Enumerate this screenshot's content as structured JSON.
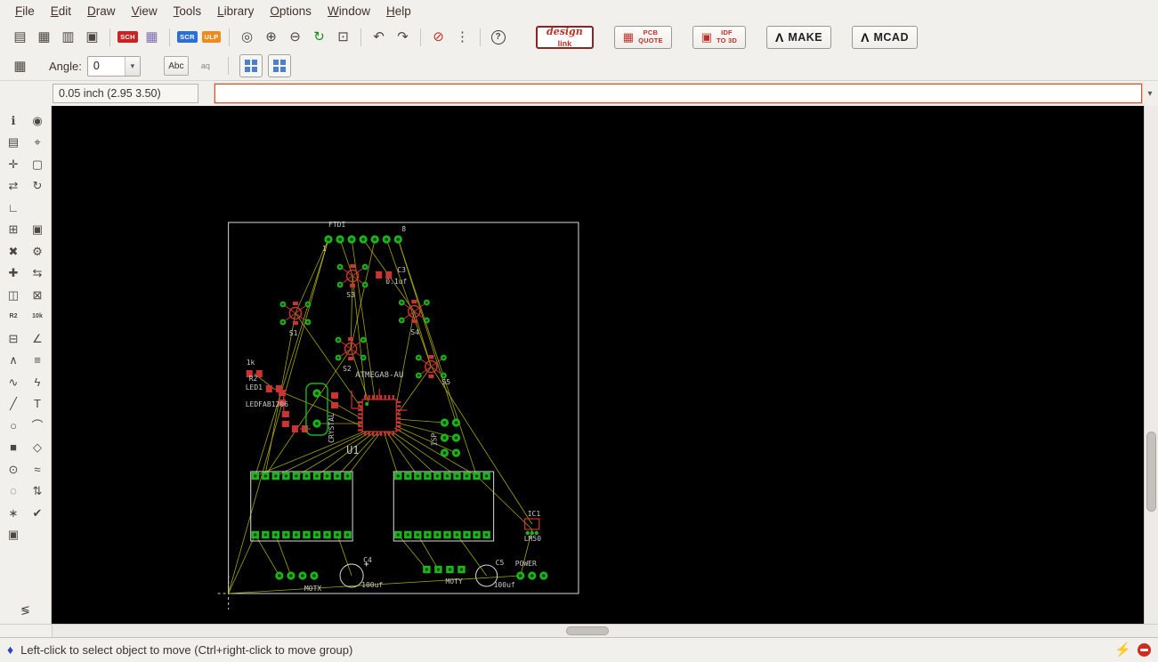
{
  "menu": {
    "items": [
      {
        "name": "menu-file",
        "label": "File"
      },
      {
        "name": "menu-edit",
        "label": "Edit"
      },
      {
        "name": "menu-draw",
        "label": "Draw"
      },
      {
        "name": "menu-view",
        "label": "View"
      },
      {
        "name": "menu-tools",
        "label": "Tools"
      },
      {
        "name": "menu-library",
        "label": "Library"
      },
      {
        "name": "menu-options",
        "label": "Options"
      },
      {
        "name": "menu-window",
        "label": "Window"
      },
      {
        "name": "menu-help",
        "label": "Help"
      }
    ]
  },
  "toolbar_main": {
    "items": [
      {
        "name": "open-button",
        "glyph": "▤"
      },
      {
        "name": "save-button",
        "glyph": "▦"
      },
      {
        "name": "print-button",
        "glyph": "▥"
      },
      {
        "name": "export-image-button",
        "glyph": "▣"
      },
      {
        "name": "separator",
        "glyph": "",
        "cls": "sep",
        "interactable": false
      },
      {
        "name": "schematic-button",
        "glyph": "SCH",
        "cls": "badge"
      },
      {
        "name": "layers-grid-button",
        "glyph": "▦",
        "cls": "c-grid"
      },
      {
        "name": "separator",
        "glyph": "",
        "cls": "sep",
        "interactable": false
      },
      {
        "name": "script-button",
        "glyph": "SCR",
        "cls": "badge badge-blue"
      },
      {
        "name": "ulp-button",
        "glyph": "ULP",
        "cls": "badge badge-orange"
      },
      {
        "name": "separator",
        "glyph": "",
        "cls": "sep",
        "interactable": false
      },
      {
        "name": "zoom-fit-button",
        "glyph": "◎"
      },
      {
        "name": "zoom-in-button",
        "glyph": "⊕"
      },
      {
        "name": "zoom-out-button",
        "glyph": "⊖"
      },
      {
        "name": "zoom-redraw-button",
        "glyph": "↻",
        "cls": "c-green"
      },
      {
        "name": "zoom-select-button",
        "glyph": "⊡"
      },
      {
        "name": "separator",
        "glyph": "",
        "cls": "sep",
        "interactable": false
      },
      {
        "name": "undo-button",
        "glyph": "↶"
      },
      {
        "name": "redo-button",
        "glyph": "↷"
      },
      {
        "name": "separator",
        "glyph": "",
        "cls": "sep",
        "interactable": false
      },
      {
        "name": "stop-button",
        "glyph": "⊘",
        "cls": "c-red"
      },
      {
        "name": "options-dots-button",
        "glyph": "⋮"
      },
      {
        "name": "separator",
        "glyph": "",
        "cls": "sep",
        "interactable": false
      },
      {
        "name": "help-button",
        "glyph": "?",
        "cls": "circle"
      }
    ]
  },
  "vendor": {
    "design_top": "design",
    "design_bottom": "link",
    "pcb_icon": "▦",
    "pcb_line1": "PCB",
    "pcb_line2": "QUOTE",
    "idf_icon": "▣",
    "idf_line1": "IDF",
    "idf_line2": "TO 3D",
    "make_logo": "Λ",
    "make_label": "MAKE",
    "mcad_logo": "Λ",
    "mcad_label": "MCAD"
  },
  "toolbar_params": {
    "grid_icon": "▦",
    "angle_label": "Angle:",
    "angle_value": "0",
    "abc_label": "Abc",
    "ratio_label": "aq",
    "dropdown_icon": "▾"
  },
  "command_bar": {
    "coordinates": "0.05 inch (2.95 3.50)",
    "value": ""
  },
  "left_tools": {
    "items": [
      {
        "name": "info-tool",
        "glyph": "ℹ"
      },
      {
        "name": "show-tool",
        "glyph": "◉"
      },
      {
        "name": "display-layers-tool",
        "glyph": "▤",
        "cls": "c-blue"
      },
      {
        "name": "mark-tool",
        "glyph": "⌖"
      },
      {
        "name": "move-tool",
        "glyph": "✛"
      },
      {
        "name": "group-tool",
        "glyph": "▢"
      },
      {
        "name": "mirror-tool",
        "glyph": "⇄"
      },
      {
        "name": "rotate-tool",
        "glyph": "↻"
      },
      {
        "name": "wire-bend-tool",
        "glyph": "∟"
      },
      {
        "name": "spacer",
        "glyph": "",
        "cls": "spacer",
        "interactable": false
      },
      {
        "name": "copy-tool",
        "glyph": "⊞"
      },
      {
        "name": "paste-tool",
        "glyph": "▣"
      },
      {
        "name": "delete-tool",
        "glyph": "✖"
      },
      {
        "name": "change-tool",
        "glyph": "⚙"
      },
      {
        "name": "add-tool",
        "glyph": "✚",
        "cls": "c-green"
      },
      {
        "name": "pinswap-tool",
        "glyph": "⇆"
      },
      {
        "name": "replace-tool",
        "glyph": "◫"
      },
      {
        "name": "lock-tool",
        "glyph": "⊠"
      },
      {
        "name": "name-tool",
        "glyph": "R2",
        "cls": "tiny"
      },
      {
        "name": "value-tool",
        "glyph": "10k",
        "cls": "tiny"
      },
      {
        "name": "smash-tool",
        "glyph": "⊟"
      },
      {
        "name": "miter-tool",
        "glyph": "∠"
      },
      {
        "name": "split-tool",
        "glyph": "∧"
      },
      {
        "name": "optimize-tool",
        "glyph": "≡"
      },
      {
        "name": "route-tool",
        "glyph": "∿",
        "cls": "c-green"
      },
      {
        "name": "ripup-tool",
        "glyph": "ϟ",
        "cls": "c-green"
      },
      {
        "name": "wire-tool",
        "glyph": "╱"
      },
      {
        "name": "text-tool",
        "glyph": "T"
      },
      {
        "name": "circle-tool",
        "glyph": "○"
      },
      {
        "name": "arc-tool",
        "glyph": "⌒"
      },
      {
        "name": "rect-tool",
        "glyph": "■"
      },
      {
        "name": "polygon-tool",
        "glyph": "◇"
      },
      {
        "name": "via-tool",
        "glyph": "⊙",
        "cls": "c-green"
      },
      {
        "name": "signal-tool",
        "glyph": "≈",
        "cls": "c-olive"
      },
      {
        "name": "hole-tool",
        "glyph": "◌"
      },
      {
        "name": "ratsnest-tool",
        "glyph": "⇅"
      },
      {
        "name": "auto-tool",
        "glyph": "∗"
      },
      {
        "name": "drc-tool",
        "glyph": "✔"
      },
      {
        "name": "errors-tool",
        "glyph": "▣",
        "cls": "c-green"
      }
    ],
    "bottom_glyph": "≶"
  },
  "status_bar": {
    "icon": "♦",
    "text": "Left-click to select object to move (Ctrl+right-click to move group)",
    "bolt_icon": "⚡"
  },
  "board": {
    "labels": {
      "ftdi": "FTDI",
      "pin1": "1",
      "pin8": "8",
      "s1": "S1",
      "s2": "S2",
      "s3": "S3",
      "s4": "S4",
      "s5": "S5",
      "c3": "C3",
      "c3_value": "0.1uf",
      "mcu_value": "ATMEGA8-AU",
      "u1": "U1",
      "crystal": "CRYSTAL",
      "isp": "ISP",
      "r2": "R2",
      "r2_value": "1k",
      "led1": "LED1",
      "led_package": "LEDFAB1206",
      "c4": "C4",
      "c4_value": "100uf",
      "c5": "C5",
      "c5_value": "100uf",
      "motx": "MOTX",
      "moty": "MOTY",
      "power": "POWER",
      "lm50": "LM50",
      "ic1": "IC1"
    }
  },
  "colors": {
    "canvas": "#000000",
    "board_outline": "#d9d9d9",
    "pad_green": "#1db31d",
    "copper_red": "#cc3333",
    "ratsnest_yellow": "#b9b900",
    "command_focus_border": "#cf5a35",
    "ui_background": "#f2f0ed"
  }
}
